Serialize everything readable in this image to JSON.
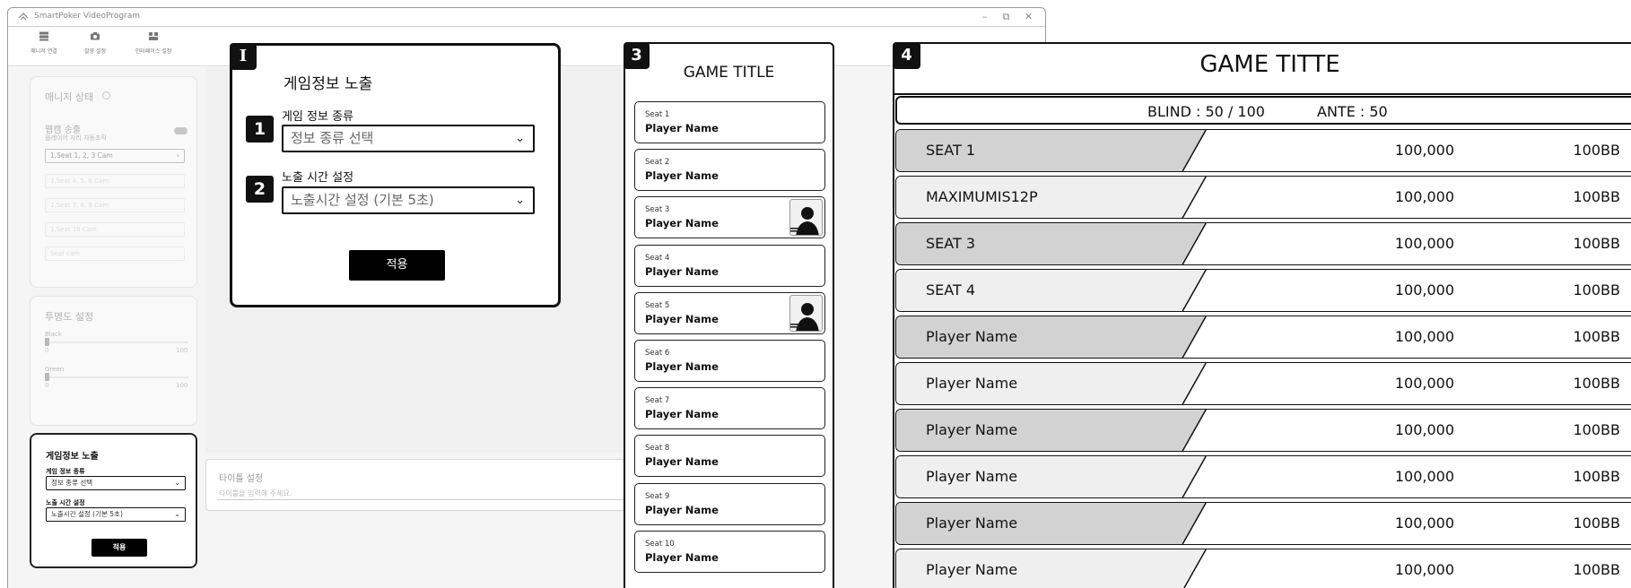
{
  "app": {
    "title": "SmartPoker VideoProgram",
    "toolbar": [
      {
        "label": "매니저 연결",
        "icon": "server-icon"
      },
      {
        "label": "촬영 설정",
        "icon": "camera-icon"
      },
      {
        "label": "인터페이스 설정",
        "icon": "layout-icon"
      }
    ],
    "manager_card": {
      "title": "매니저 상태",
      "broadcast_label": "웹캠 송출",
      "broadcast_sub": "플레이어 자리 자동조작",
      "cam_select": "1,Seat 1, 2, 3 Cam",
      "ghost_rows": [
        "1,Seat 4, 5, 6 Cam",
        "1,Seat 7, 8, 9 Cam",
        "1,Seat 10 Cam",
        "Seat cam"
      ]
    },
    "opacity_card": {
      "title": "투명도 설정",
      "sliders": [
        {
          "label": "Black",
          "min": "0",
          "max": "100",
          "value": 0
        },
        {
          "label": "Green",
          "min": "0",
          "max": "100",
          "value": 0
        }
      ]
    },
    "game_card": {
      "title": "게임정보 노출",
      "type_label": "게임 정보 종류",
      "type_select": "정보 종류 선택",
      "time_label": "노출 시간 설정",
      "time_select": "노출시간 설정 (기본 5초)",
      "apply": "적용"
    },
    "title_area": {
      "label": "타이틀 설정",
      "placeholder": "타이틀을 입력해 주세요."
    }
  },
  "panel1": {
    "badge": "I",
    "title": "게임정보 노출",
    "step1": {
      "num": "1",
      "label": "게임 정보 종류",
      "select": "정보 종류 선택"
    },
    "step2": {
      "num": "2",
      "label": "노출 시간 설정",
      "select": "노출시간 설정 (기본 5초)"
    },
    "apply": "적용"
  },
  "panel3": {
    "badge": "3",
    "title": "GAME TITLE",
    "seats": [
      {
        "seat": "Seat 1",
        "name": "Player Name",
        "photo": false
      },
      {
        "seat": "Seat 2",
        "name": "Player Name",
        "photo": false
      },
      {
        "seat": "Seat 3",
        "name": "Player Name",
        "photo": true
      },
      {
        "seat": "Seat 4",
        "name": "Player Name",
        "photo": false
      },
      {
        "seat": "Seat 5",
        "name": "Player Name",
        "photo": true
      },
      {
        "seat": "Seat 6",
        "name": "Player Name",
        "photo": false
      },
      {
        "seat": "Seat 7",
        "name": "Player Name",
        "photo": false
      },
      {
        "seat": "Seat 8",
        "name": "Player Name",
        "photo": false
      },
      {
        "seat": "Seat 9",
        "name": "Player Name",
        "photo": false
      },
      {
        "seat": "Seat 10",
        "name": "Player Name",
        "photo": false
      }
    ]
  },
  "panel4": {
    "badge": "4",
    "title": "GAME TITTE",
    "blind": "BLIND : 50 / 100",
    "ante": "ANTE : 50",
    "rows": [
      {
        "name": "SEAT 1",
        "stack": "100,000",
        "bb": "100BB",
        "shade": "dark"
      },
      {
        "name": "MAXIMUMIS12P",
        "stack": "100,000",
        "bb": "100BB",
        "shade": "light"
      },
      {
        "name": "SEAT 3",
        "stack": "100,000",
        "bb": "100BB",
        "shade": "dark"
      },
      {
        "name": "SEAT 4",
        "stack": "100,000",
        "bb": "100BB",
        "shade": "light"
      },
      {
        "name": "Player Name",
        "stack": "100,000",
        "bb": "100BB",
        "shade": "dark"
      },
      {
        "name": "Player Name",
        "stack": "100,000",
        "bb": "100BB",
        "shade": "light"
      },
      {
        "name": "Player Name",
        "stack": "100,000",
        "bb": "100BB",
        "shade": "dark"
      },
      {
        "name": "Player Name",
        "stack": "100,000",
        "bb": "100BB",
        "shade": "light"
      },
      {
        "name": "Player Name",
        "stack": "100,000",
        "bb": "100BB",
        "shade": "dark"
      },
      {
        "name": "Player Name",
        "stack": "100,000",
        "bb": "100BB",
        "shade": "light"
      }
    ]
  },
  "colors": {
    "dark_row": "#d2d2d2",
    "light_row": "#efefef",
    "accent": "#111111"
  }
}
